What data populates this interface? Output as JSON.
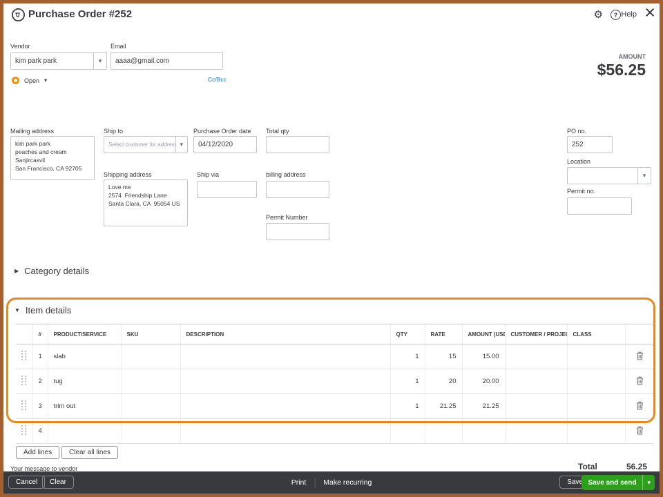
{
  "icons": {
    "gear": "⚙",
    "help_q": "?",
    "close": "×",
    "caret_down": "▾",
    "section_collapsed": "▶",
    "section_expanded": "▼"
  },
  "header": {
    "title": "Purchase Order #252",
    "help": "Help"
  },
  "top": {
    "vendor_label": "Vendor",
    "vendor_value": "kim park park",
    "email_label": "Email",
    "email_value": "aaaa@gmail.com",
    "ccbcc": "Cc/Bcc",
    "status": "Open",
    "amount_label": "AMOUNT",
    "amount_value": "$56.25"
  },
  "fields": {
    "mailing_label": "Mailing address",
    "mailing_lines": [
      "kim park park",
      "peaches and cream",
      "Sanjircasvil",
      "San Francisco, CA  92705"
    ],
    "shipto_label": "Ship to",
    "shipto_placeholder": "Select customer for address",
    "date_label": "Purchase Order date",
    "date_value": "04/12/2020",
    "totalqty_label": "Total qty",
    "pono_label": "PO no.",
    "pono_value": "252",
    "location_label": "Location",
    "shipaddr_label": "Shipping address",
    "shipaddr_value": "Love me\n2574  Friendship Lane\nSanta Clara, CA  95054 US",
    "shipvia_label": "Ship via",
    "billing_label": "billing address",
    "permitno_label": "Permit no.",
    "permitnumber_label": "Permit Number"
  },
  "sections": {
    "category": "Category details",
    "item": "Item details"
  },
  "table": {
    "headers": [
      "#",
      "PRODUCT/SERVICE",
      "SKU",
      "DESCRIPTION",
      "QTY",
      "RATE",
      "AMOUNT (USD)",
      "CUSTOMER / PROJECT",
      "CLASS"
    ],
    "rows": [
      {
        "n": "1",
        "product": "slab",
        "sku": "",
        "desc": "",
        "qty": "1",
        "rate": "15",
        "amount": "15.00",
        "customer": "",
        "cls": ""
      },
      {
        "n": "2",
        "product": "tug",
        "sku": "",
        "desc": "",
        "qty": "1",
        "rate": "20",
        "amount": "20.00",
        "customer": "",
        "cls": ""
      },
      {
        "n": "3",
        "product": "trim out",
        "sku": "",
        "desc": "",
        "qty": "1",
        "rate": "21.25",
        "amount": "21.25",
        "customer": "",
        "cls": ""
      },
      {
        "n": "4",
        "product": "",
        "sku": "",
        "desc": "",
        "qty": "",
        "rate": "",
        "amount": "",
        "customer": "",
        "cls": ""
      }
    ]
  },
  "buttons": {
    "add_lines": "Add lines",
    "clear_all": "Clear all lines"
  },
  "message_label": "Your message to vendor",
  "total": {
    "label": "Total",
    "value": "56.25"
  },
  "footer": {
    "cancel": "Cancel",
    "clear": "Clear",
    "print": "Print",
    "make_recurring": "Make recurring",
    "save": "Save",
    "save_and_send": "Save and send"
  },
  "colors": {
    "accent_green": "#2ca01c",
    "footer_dark": "#393a3d",
    "link_blue": "#0077c5",
    "status_orange": "#ff8c00",
    "annotation_orange": "#e8891c",
    "frame_brown": "#a4612f"
  }
}
